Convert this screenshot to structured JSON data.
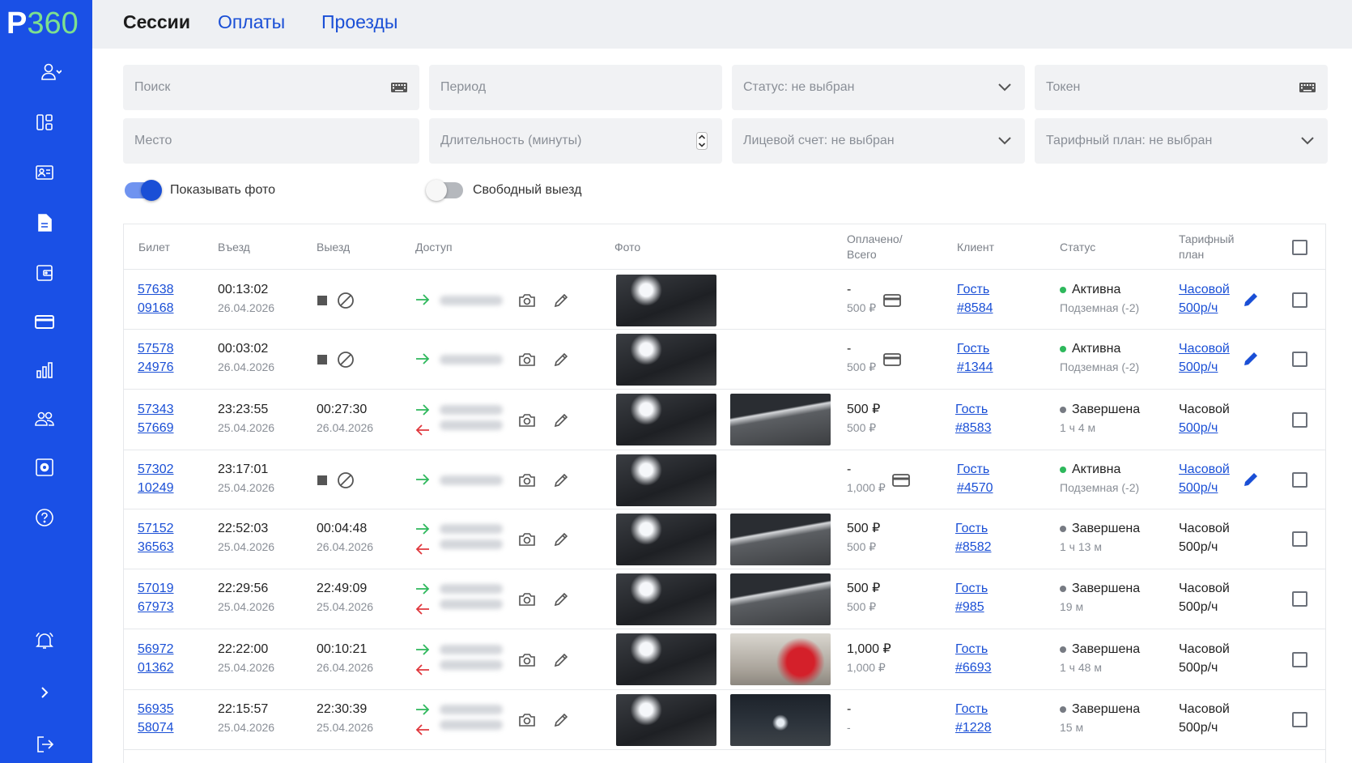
{
  "app": {
    "logo_p": "P",
    "logo_num": "360"
  },
  "colors": {
    "brand": "#1a50e6",
    "accent_green": "#2eb85c",
    "link": "#1a4fd6",
    "status_finished": "#777b83"
  },
  "sidebar": {
    "items": [
      "user-icon",
      "dashboard-icon",
      "contact-card-icon",
      "document-icon",
      "wallet-icon",
      "card-icon",
      "chart-icon",
      "users-icon",
      "settings-icon",
      "help-icon",
      "bell-icon",
      "expand-icon",
      "logout-icon"
    ]
  },
  "tabs": [
    {
      "label": "Сессии",
      "active": true
    },
    {
      "label": "Оплаты",
      "active": false
    },
    {
      "label": "Проезды",
      "active": false
    }
  ],
  "filters": {
    "search": "Поиск",
    "period": "Период",
    "status": "Статус: не выбран",
    "token": "Токен",
    "place": "Место",
    "duration": "Длительность (минуты)",
    "account": "Лицевой счет: не выбран",
    "tariff": "Тарифный план: не выбран"
  },
  "toggles": {
    "show_photo": {
      "label": "Показывать фото",
      "on": true
    },
    "free_exit": {
      "label": "Свободный выезд",
      "on": false
    }
  },
  "table": {
    "headers": {
      "ticket": "Билет",
      "entry": "Въезд",
      "exit": "Выезд",
      "access": "Доступ",
      "photo": "Фото",
      "paid_line1": "Оплачено/",
      "paid_line2": "Всего",
      "client": "Клиент",
      "status": "Статус",
      "tariff_line1": "Тарифный",
      "tariff_line2": "план"
    },
    "rows": [
      {
        "ticket1": "57638",
        "ticket2": "09168",
        "entry_time": "00:13:02",
        "entry_date": "26.04.2026",
        "exit_time": "",
        "exit_date": "",
        "active": true,
        "paid": "-",
        "total": "500 ₽",
        "client1": "Гость",
        "client2": "#8584",
        "status": "Активна",
        "status_sub": "Подземная (-2)",
        "tariff1": "Часовой",
        "tariff2": "500р/ч",
        "tariff_link": true,
        "photos": 1
      },
      {
        "ticket1": "57578",
        "ticket2": "24976",
        "entry_time": "00:03:02",
        "entry_date": "26.04.2026",
        "exit_time": "",
        "exit_date": "",
        "active": true,
        "paid": "-",
        "total": "500 ₽",
        "client1": "Гость",
        "client2": "#1344",
        "status": "Активна",
        "status_sub": "Подземная (-2)",
        "tariff1": "Часовой",
        "tariff2": "500р/ч",
        "tariff_link": true,
        "photos": 1
      },
      {
        "ticket1": "57343",
        "ticket2": "57669",
        "entry_time": "23:23:55",
        "entry_date": "25.04.2026",
        "exit_time": "00:27:30",
        "exit_date": "26.04.2026",
        "active": false,
        "paid": "500 ₽",
        "total": "500 ₽",
        "client1": "Гость",
        "client2": "#8583",
        "status": "Завершена",
        "status_sub": "1 ч 4 м",
        "tariff1": "Часовой",
        "tariff2": "500р/ч",
        "tariff_link": false,
        "tariff2_link": true,
        "photos": 2
      },
      {
        "ticket1": "57302",
        "ticket2": "10249",
        "entry_time": "23:17:01",
        "entry_date": "25.04.2026",
        "exit_time": "",
        "exit_date": "",
        "active": true,
        "paid": "-",
        "total": "1,000 ₽",
        "client1": "Гость",
        "client2": "#4570",
        "status": "Активна",
        "status_sub": "Подземная (-2)",
        "tariff1": "Часовой",
        "tariff2": "500р/ч",
        "tariff_link": true,
        "photos": 1
      },
      {
        "ticket1": "57152",
        "ticket2": "36563",
        "entry_time": "22:52:03",
        "entry_date": "25.04.2026",
        "exit_time": "00:04:48",
        "exit_date": "26.04.2026",
        "active": false,
        "paid": "500 ₽",
        "total": "500 ₽",
        "client1": "Гость",
        "client2": "#8582",
        "status": "Завершена",
        "status_sub": "1 ч 13 м",
        "tariff1": "Часовой",
        "tariff2": "500р/ч",
        "tariff_link": false,
        "photos": 2
      },
      {
        "ticket1": "57019",
        "ticket2": "67973",
        "entry_time": "22:29:56",
        "entry_date": "25.04.2026",
        "exit_time": "22:49:09",
        "exit_date": "25.04.2026",
        "active": false,
        "paid": "500 ₽",
        "total": "500 ₽",
        "client1": "Гость",
        "client2": "#985",
        "status": "Завершена",
        "status_sub": "19 м",
        "tariff1": "Часовой",
        "tariff2": "500р/ч",
        "tariff_link": false,
        "photos": 2
      },
      {
        "ticket1": "56972",
        "ticket2": "01362",
        "entry_time": "22:22:00",
        "entry_date": "25.04.2026",
        "exit_time": "00:10:21",
        "exit_date": "26.04.2026",
        "active": false,
        "paid": "1,000 ₽",
        "total": "1,000 ₽",
        "client1": "Гость",
        "client2": "#6693",
        "status": "Завершена",
        "status_sub": "1 ч 48 м",
        "tariff1": "Часовой",
        "tariff2": "500р/ч",
        "tariff_link": false,
        "photos": 2
      },
      {
        "ticket1": "56935",
        "ticket2": "58074",
        "entry_time": "22:15:57",
        "entry_date": "25.04.2026",
        "exit_time": "22:30:39",
        "exit_date": "25.04.2026",
        "active": false,
        "paid": "-",
        "total": "-",
        "client1": "Гость",
        "client2": "#1228",
        "status": "Завершена",
        "status_sub": "15 м",
        "tariff1": "Часовой",
        "tariff2": "500р/ч",
        "tariff_link": false,
        "photos": 2
      }
    ]
  }
}
